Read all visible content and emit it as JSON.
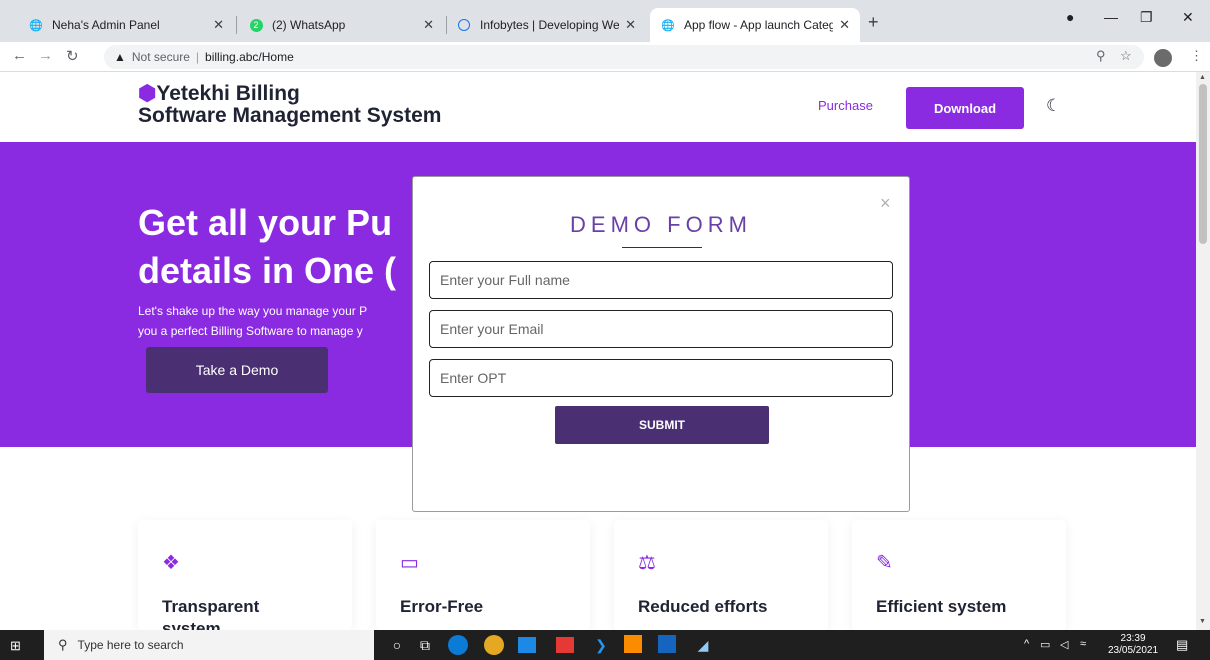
{
  "browser": {
    "tabs": [
      {
        "title": "Neha's Admin Panel",
        "favicon": "globe-icon"
      },
      {
        "title": "(2) WhatsApp",
        "favicon": "whatsapp-icon",
        "badge": "2"
      },
      {
        "title": "Infobytes | Developing Websites,",
        "favicon": "infobytes-icon"
      },
      {
        "title": "App flow - App launch Category",
        "favicon": "globe-icon",
        "active": true
      }
    ],
    "address": {
      "security": "Not secure",
      "url": "billing.abc/Home"
    }
  },
  "site": {
    "brand_line1": "Yetekhi Billing",
    "brand_line2": "Software Management System",
    "nav_purchase": "Purchase",
    "download_label": "Download"
  },
  "hero": {
    "title_line1": "Get all your Pu",
    "title_line2": "details in One (",
    "text_line1": "Let's shake up the way you manage your P",
    "text_line2": "you a perfect Billing Software to manage y",
    "demo_button": "Take a Demo",
    "bg_color": "#8a2be2"
  },
  "modal": {
    "title": "DEMO FORM",
    "close": "×",
    "fields": {
      "name_placeholder": "Enter your Full name",
      "email_placeholder": "Enter your Email",
      "otp_placeholder": "Enter OPT"
    },
    "submit_label": "SUBMIT"
  },
  "features": [
    {
      "title": "Transparent system",
      "icon": "cubes-icon"
    },
    {
      "title": "Error-Free",
      "icon": "laptop-icon"
    },
    {
      "title": "Reduced efforts",
      "icon": "balance-scale-icon"
    },
    {
      "title": "Efficient system",
      "icon": "edit-icon"
    }
  ],
  "taskbar": {
    "search_placeholder": "Type here to search",
    "time": "23:39",
    "date": "23/05/2021"
  }
}
